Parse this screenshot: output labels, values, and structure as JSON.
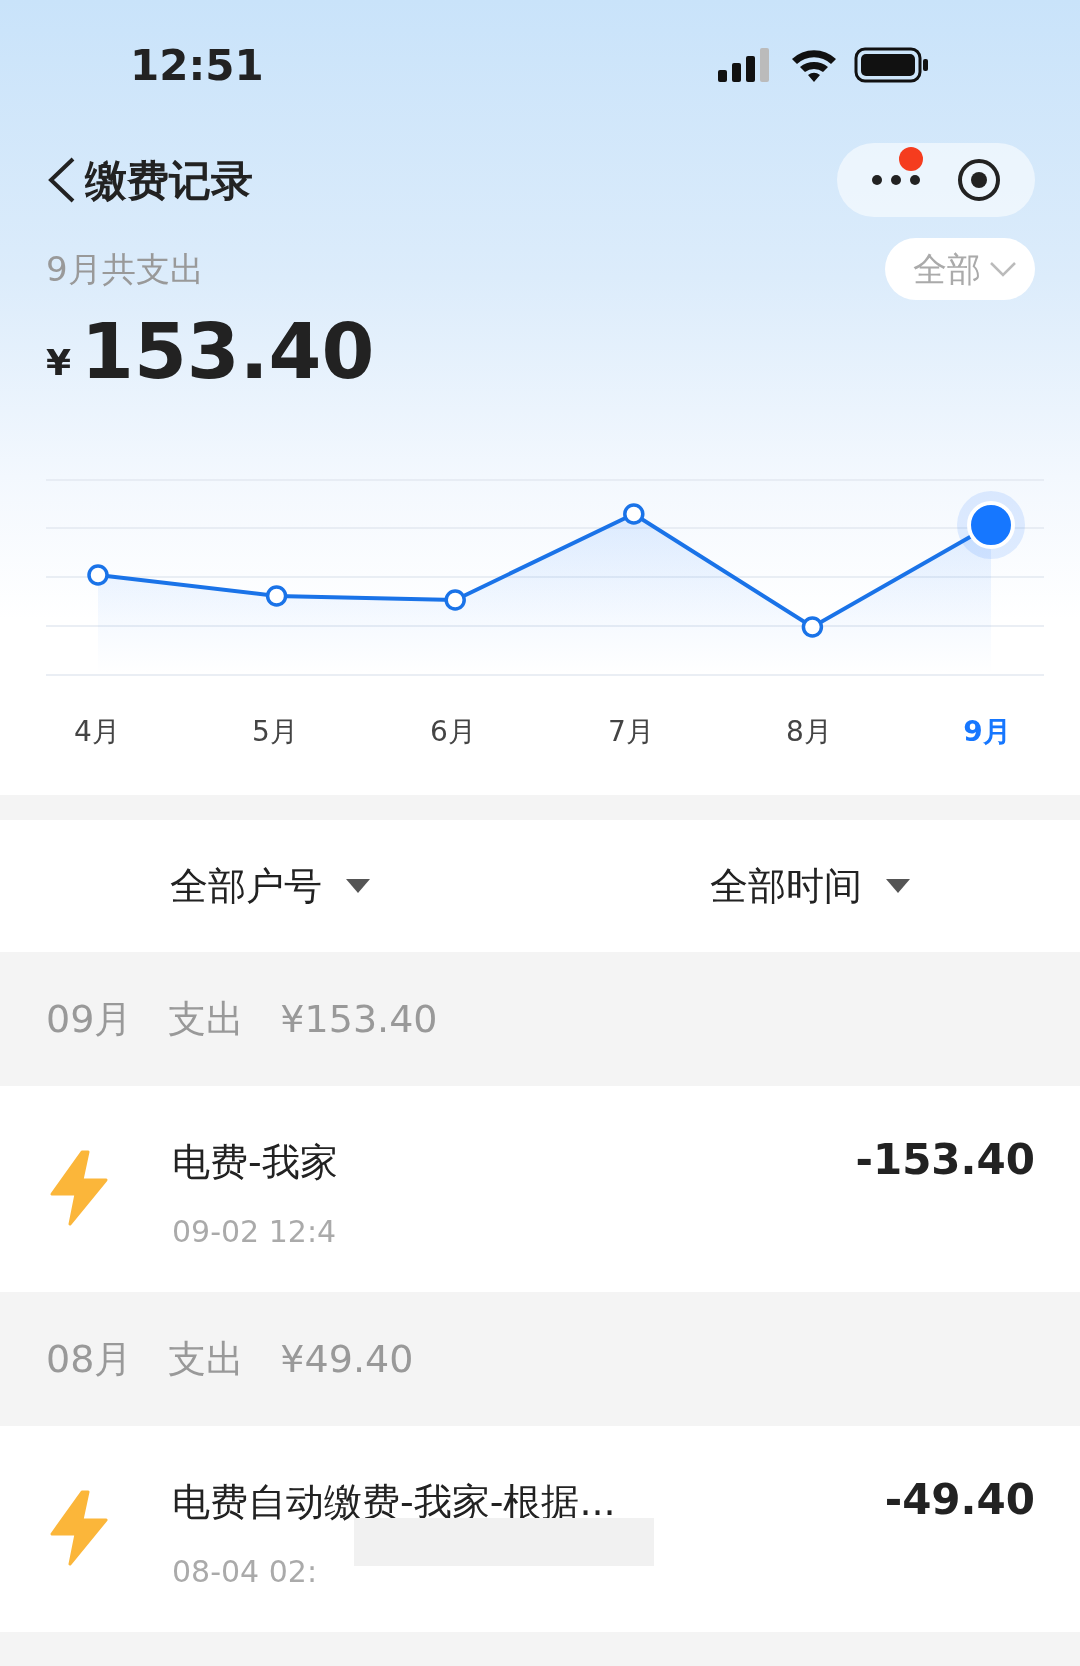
{
  "status_bar": {
    "time": "12:51"
  },
  "header": {
    "title": "缴费记录",
    "has_notification": true
  },
  "summary": {
    "label": "9月共支出",
    "currency": "¥",
    "amount": "153.40",
    "filter": "全部"
  },
  "chart": {
    "months": [
      {
        "label": "4月",
        "selected": false
      },
      {
        "label": "5月",
        "selected": false
      },
      {
        "label": "6月",
        "selected": false
      },
      {
        "label": "7月",
        "selected": false
      },
      {
        "label": "8月",
        "selected": false
      },
      {
        "label": "9月",
        "selected": true
      }
    ]
  },
  "filters": [
    "全部户号",
    "全部时间"
  ],
  "groups": [
    {
      "month": "09月",
      "label": "支出",
      "total": "¥153.40",
      "items": [
        {
          "title": "电费-我家",
          "time": "09-02 12:4",
          "amount": "-153.40"
        }
      ]
    },
    {
      "month": "08月",
      "label": "支出",
      "total": "¥49.40",
      "items": [
        {
          "title": "电费自动缴费-我家-根据...",
          "time": "08-04 02:",
          "amount": "-49.40",
          "redacted": true
        }
      ]
    }
  ]
}
